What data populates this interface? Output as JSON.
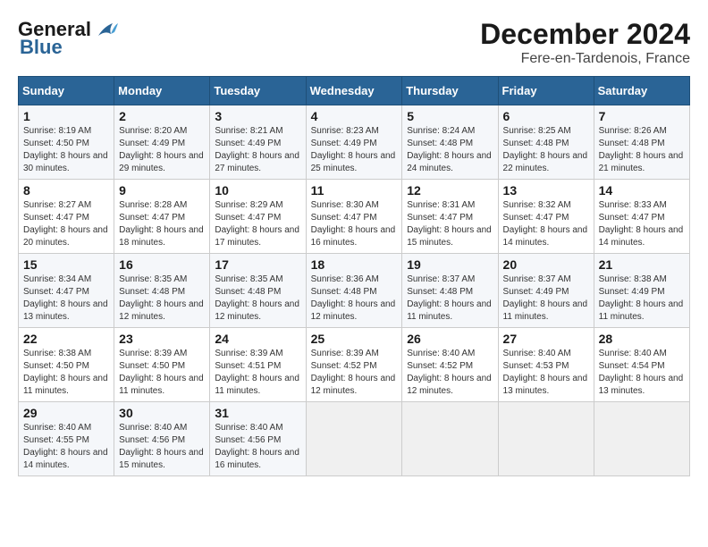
{
  "header": {
    "logo_line1": "General",
    "logo_line2": "Blue",
    "title": "December 2024",
    "subtitle": "Fere-en-Tardenois, France"
  },
  "days_of_week": [
    "Sunday",
    "Monday",
    "Tuesday",
    "Wednesday",
    "Thursday",
    "Friday",
    "Saturday"
  ],
  "weeks": [
    [
      {
        "day": "1",
        "info": "Sunrise: 8:19 AM\nSunset: 4:50 PM\nDaylight: 8 hours and 30 minutes."
      },
      {
        "day": "2",
        "info": "Sunrise: 8:20 AM\nSunset: 4:49 PM\nDaylight: 8 hours and 29 minutes."
      },
      {
        "day": "3",
        "info": "Sunrise: 8:21 AM\nSunset: 4:49 PM\nDaylight: 8 hours and 27 minutes."
      },
      {
        "day": "4",
        "info": "Sunrise: 8:23 AM\nSunset: 4:49 PM\nDaylight: 8 hours and 25 minutes."
      },
      {
        "day": "5",
        "info": "Sunrise: 8:24 AM\nSunset: 4:48 PM\nDaylight: 8 hours and 24 minutes."
      },
      {
        "day": "6",
        "info": "Sunrise: 8:25 AM\nSunset: 4:48 PM\nDaylight: 8 hours and 22 minutes."
      },
      {
        "day": "7",
        "info": "Sunrise: 8:26 AM\nSunset: 4:48 PM\nDaylight: 8 hours and 21 minutes."
      }
    ],
    [
      {
        "day": "8",
        "info": "Sunrise: 8:27 AM\nSunset: 4:47 PM\nDaylight: 8 hours and 20 minutes."
      },
      {
        "day": "9",
        "info": "Sunrise: 8:28 AM\nSunset: 4:47 PM\nDaylight: 8 hours and 18 minutes."
      },
      {
        "day": "10",
        "info": "Sunrise: 8:29 AM\nSunset: 4:47 PM\nDaylight: 8 hours and 17 minutes."
      },
      {
        "day": "11",
        "info": "Sunrise: 8:30 AM\nSunset: 4:47 PM\nDaylight: 8 hours and 16 minutes."
      },
      {
        "day": "12",
        "info": "Sunrise: 8:31 AM\nSunset: 4:47 PM\nDaylight: 8 hours and 15 minutes."
      },
      {
        "day": "13",
        "info": "Sunrise: 8:32 AM\nSunset: 4:47 PM\nDaylight: 8 hours and 14 minutes."
      },
      {
        "day": "14",
        "info": "Sunrise: 8:33 AM\nSunset: 4:47 PM\nDaylight: 8 hours and 14 minutes."
      }
    ],
    [
      {
        "day": "15",
        "info": "Sunrise: 8:34 AM\nSunset: 4:47 PM\nDaylight: 8 hours and 13 minutes."
      },
      {
        "day": "16",
        "info": "Sunrise: 8:35 AM\nSunset: 4:48 PM\nDaylight: 8 hours and 12 minutes."
      },
      {
        "day": "17",
        "info": "Sunrise: 8:35 AM\nSunset: 4:48 PM\nDaylight: 8 hours and 12 minutes."
      },
      {
        "day": "18",
        "info": "Sunrise: 8:36 AM\nSunset: 4:48 PM\nDaylight: 8 hours and 12 minutes."
      },
      {
        "day": "19",
        "info": "Sunrise: 8:37 AM\nSunset: 4:48 PM\nDaylight: 8 hours and 11 minutes."
      },
      {
        "day": "20",
        "info": "Sunrise: 8:37 AM\nSunset: 4:49 PM\nDaylight: 8 hours and 11 minutes."
      },
      {
        "day": "21",
        "info": "Sunrise: 8:38 AM\nSunset: 4:49 PM\nDaylight: 8 hours and 11 minutes."
      }
    ],
    [
      {
        "day": "22",
        "info": "Sunrise: 8:38 AM\nSunset: 4:50 PM\nDaylight: 8 hours and 11 minutes."
      },
      {
        "day": "23",
        "info": "Sunrise: 8:39 AM\nSunset: 4:50 PM\nDaylight: 8 hours and 11 minutes."
      },
      {
        "day": "24",
        "info": "Sunrise: 8:39 AM\nSunset: 4:51 PM\nDaylight: 8 hours and 11 minutes."
      },
      {
        "day": "25",
        "info": "Sunrise: 8:39 AM\nSunset: 4:52 PM\nDaylight: 8 hours and 12 minutes."
      },
      {
        "day": "26",
        "info": "Sunrise: 8:40 AM\nSunset: 4:52 PM\nDaylight: 8 hours and 12 minutes."
      },
      {
        "day": "27",
        "info": "Sunrise: 8:40 AM\nSunset: 4:53 PM\nDaylight: 8 hours and 13 minutes."
      },
      {
        "day": "28",
        "info": "Sunrise: 8:40 AM\nSunset: 4:54 PM\nDaylight: 8 hours and 13 minutes."
      }
    ],
    [
      {
        "day": "29",
        "info": "Sunrise: 8:40 AM\nSunset: 4:55 PM\nDaylight: 8 hours and 14 minutes."
      },
      {
        "day": "30",
        "info": "Sunrise: 8:40 AM\nSunset: 4:56 PM\nDaylight: 8 hours and 15 minutes."
      },
      {
        "day": "31",
        "info": "Sunrise: 8:40 AM\nSunset: 4:56 PM\nDaylight: 8 hours and 16 minutes."
      },
      null,
      null,
      null,
      null
    ]
  ]
}
